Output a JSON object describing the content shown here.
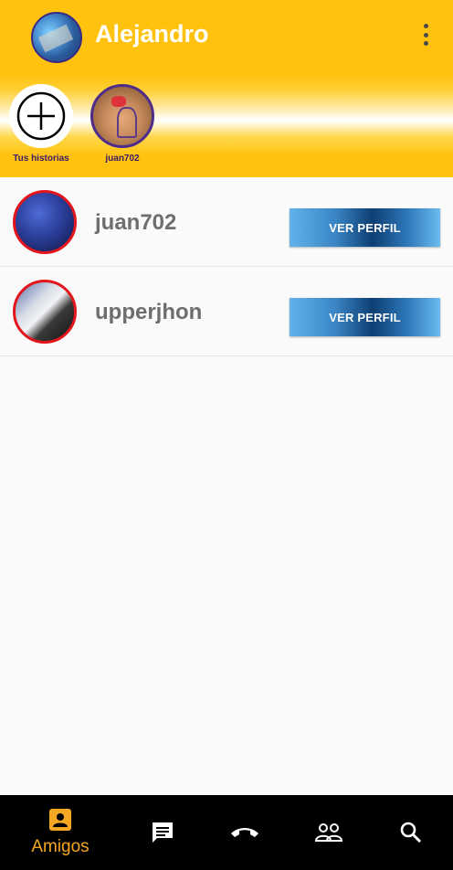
{
  "header": {
    "user_name": "Alejandro"
  },
  "stories": [
    {
      "label": "Tus historias"
    },
    {
      "label": "juan702"
    }
  ],
  "friends": [
    {
      "name": "juan702",
      "button_label": "VER PERFIL"
    },
    {
      "name": "upperjhon",
      "button_label": "VER PERFIL"
    }
  ],
  "bottom_nav": {
    "active_label": "Amigos",
    "items": [
      {
        "icon": "contact-icon"
      },
      {
        "icon": "chat-icon"
      },
      {
        "icon": "phone-hangup-icon"
      },
      {
        "icon": "group-icon"
      },
      {
        "icon": "search-icon"
      }
    ]
  },
  "colors": {
    "header_yellow": "#ffc20e",
    "active_nav": "#f5a623",
    "avatar_border": "#e3151d",
    "button_blue": "#3a86c6"
  }
}
